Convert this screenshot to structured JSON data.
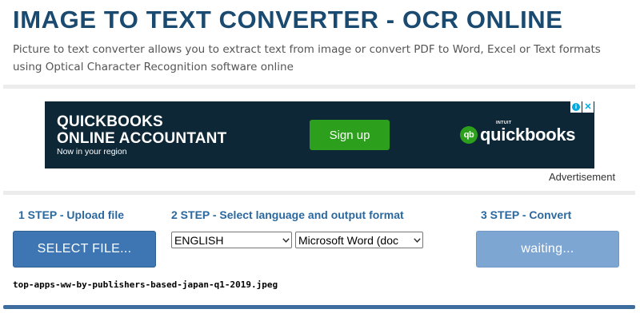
{
  "header": {
    "title": "IMAGE TO TEXT CONVERTER - OCR ONLINE",
    "description": "Picture to text converter allows you to extract text from image or convert PDF to Word, Excel or Text formats using Optical Character Recognition software online"
  },
  "ad": {
    "title_line1": "QUICKBOOKS",
    "title_line2": "ONLINE ACCOUNTANT",
    "subtitle": "Now in your region",
    "signup_label": "Sign up",
    "brand_small": "INTUIT",
    "brand_name": "quickbooks",
    "brand_logo": "qb",
    "info_glyph": "i",
    "close_glyph": "✕",
    "label": "Advertisement",
    "colors": {
      "background": "#0d2737",
      "button": "#2ca01c"
    }
  },
  "steps": {
    "step1": {
      "label": "1 STEP - Upload file",
      "button": "SELECT FILE..."
    },
    "step2": {
      "label": "2 STEP - Select language and output format",
      "language": "ENGLISH",
      "format": "Microsoft Word (doc"
    },
    "step3": {
      "label": "3 STEP - Convert",
      "button": "waiting..."
    }
  },
  "file": {
    "name": "top-apps-ww-by-publishers-based-japan-q1-2019.jpeg"
  },
  "colors": {
    "accent": "#1b4a70",
    "step_text": "#2a68a0",
    "button": "#3e76b3",
    "button_disabled": "#7ea6d3"
  }
}
